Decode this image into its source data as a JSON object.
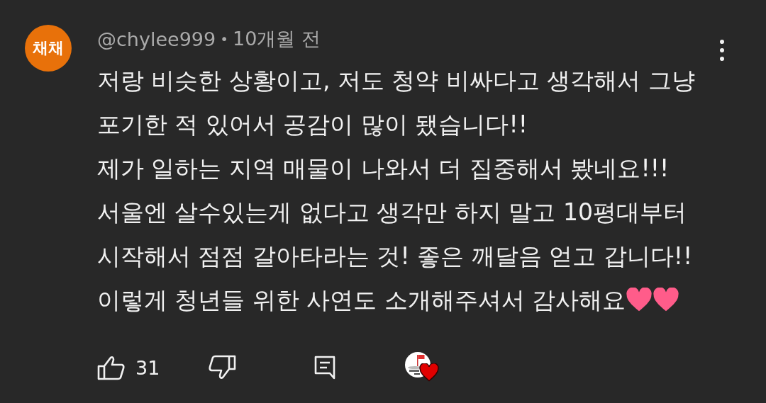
{
  "comment": {
    "author": "@chylee999",
    "separator": "•",
    "time": "10개월 전",
    "avatar_text": "채채",
    "lines": [
      "저랑 비슷한 상황이고, 저도 청약 비싸다고 생각해서 그냥",
      "포기한 적 있어서 공감이 많이 됐습니다!!",
      "제가 일하는 지역 매물이 나와서 더 집중해서 봤네요!!!",
      "서울엔 살수있는게 없다고 생각만 하지 말고 10평대부터",
      "시작해서 점점 갈아타라는 것! 좋은 깨달음 얻고 갑니다!!",
      "이렇게 청년들 위한 사연도 소개해주셔서 감사해요"
    ],
    "like_count": "31",
    "creator_hearted": true
  }
}
